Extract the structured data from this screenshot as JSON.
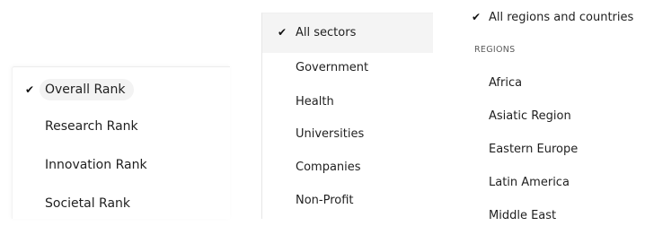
{
  "rank_menu": {
    "items": [
      {
        "label": "Overall Rank",
        "selected": true
      },
      {
        "label": "Research Rank",
        "selected": false
      },
      {
        "label": "Innovation Rank",
        "selected": false
      },
      {
        "label": "Societal Rank",
        "selected": false
      }
    ]
  },
  "sector_menu": {
    "items": [
      {
        "label": "All sectors",
        "selected": true
      },
      {
        "label": "Government",
        "selected": false
      },
      {
        "label": "Health",
        "selected": false
      },
      {
        "label": "Universities",
        "selected": false
      },
      {
        "label": "Companies",
        "selected": false
      },
      {
        "label": "Non-Profit",
        "selected": false
      }
    ]
  },
  "region_menu": {
    "all_option": {
      "label": "All regions and countries",
      "selected": true
    },
    "section_heading": "REGIONS",
    "regions": [
      {
        "label": "Africa"
      },
      {
        "label": "Asiatic Region"
      },
      {
        "label": "Eastern Europe"
      },
      {
        "label": "Latin America"
      },
      {
        "label": "Middle East"
      }
    ]
  },
  "icons": {
    "checkmark": "✔"
  }
}
